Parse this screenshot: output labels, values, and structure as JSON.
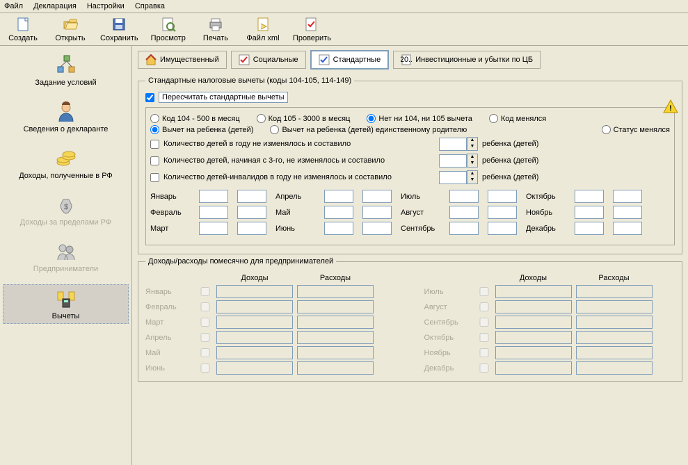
{
  "menu": {
    "file": "Файл",
    "decl": "Декларация",
    "settings": "Настройки",
    "help": "Справка"
  },
  "toolbar": {
    "create": "Создать",
    "open": "Открыть",
    "save": "Сохранить",
    "preview": "Просмотр",
    "print": "Печать",
    "xml": "Файл xml",
    "check": "Проверить"
  },
  "sidebar": {
    "conditions": "Задание условий",
    "declarant": "Сведения о декларанте",
    "income_rf": "Доходы, полученные в РФ",
    "income_abroad": "Доходы за пределами РФ",
    "entrepreneurs": "Предприниматели",
    "deductions": "Вычеты"
  },
  "tabs": {
    "property": "Имущественный",
    "social": "Социальные",
    "standard": "Стандартные",
    "invest": "Инвестиционные и убытки по ЦБ"
  },
  "fs1": {
    "legend": "Стандартные налоговые вычеты (коды 104-105, 114-149)",
    "recalc": "Пересчитать стандартные вычеты"
  },
  "radios1": {
    "r1": "Код 104 - 500 в месяц",
    "r2": "Код 105 - 3000 в месяц",
    "r3": "Нет ни 104, ни 105 вычета",
    "r4": "Код менялся"
  },
  "radios2": {
    "r1": "Вычет на ребенка (детей)",
    "r2": "Вычет на ребенка (детей) единственному родителю",
    "r3": "Статус менялся"
  },
  "children": {
    "c1": "Количество детей в году не изменялось и составило",
    "c2": "Количество детей, начиная с 3-го, не изменялось и составило",
    "c3": "Количество детей-инвалидов в году не изменялось и составило",
    "suffix": "ребенка (детей)"
  },
  "months": {
    "jan": "Январь",
    "feb": "Февраль",
    "mar": "Март",
    "apr": "Апрель",
    "may": "Май",
    "jun": "Июнь",
    "jul": "Июль",
    "aug": "Август",
    "sep": "Сентябрь",
    "oct": "Октябрь",
    "nov": "Ноябрь",
    "dec": "Декабрь"
  },
  "fs2": {
    "legend": "Доходы/расходы помесячно для предпринимателей",
    "income": "Доходы",
    "expense": "Расходы"
  }
}
